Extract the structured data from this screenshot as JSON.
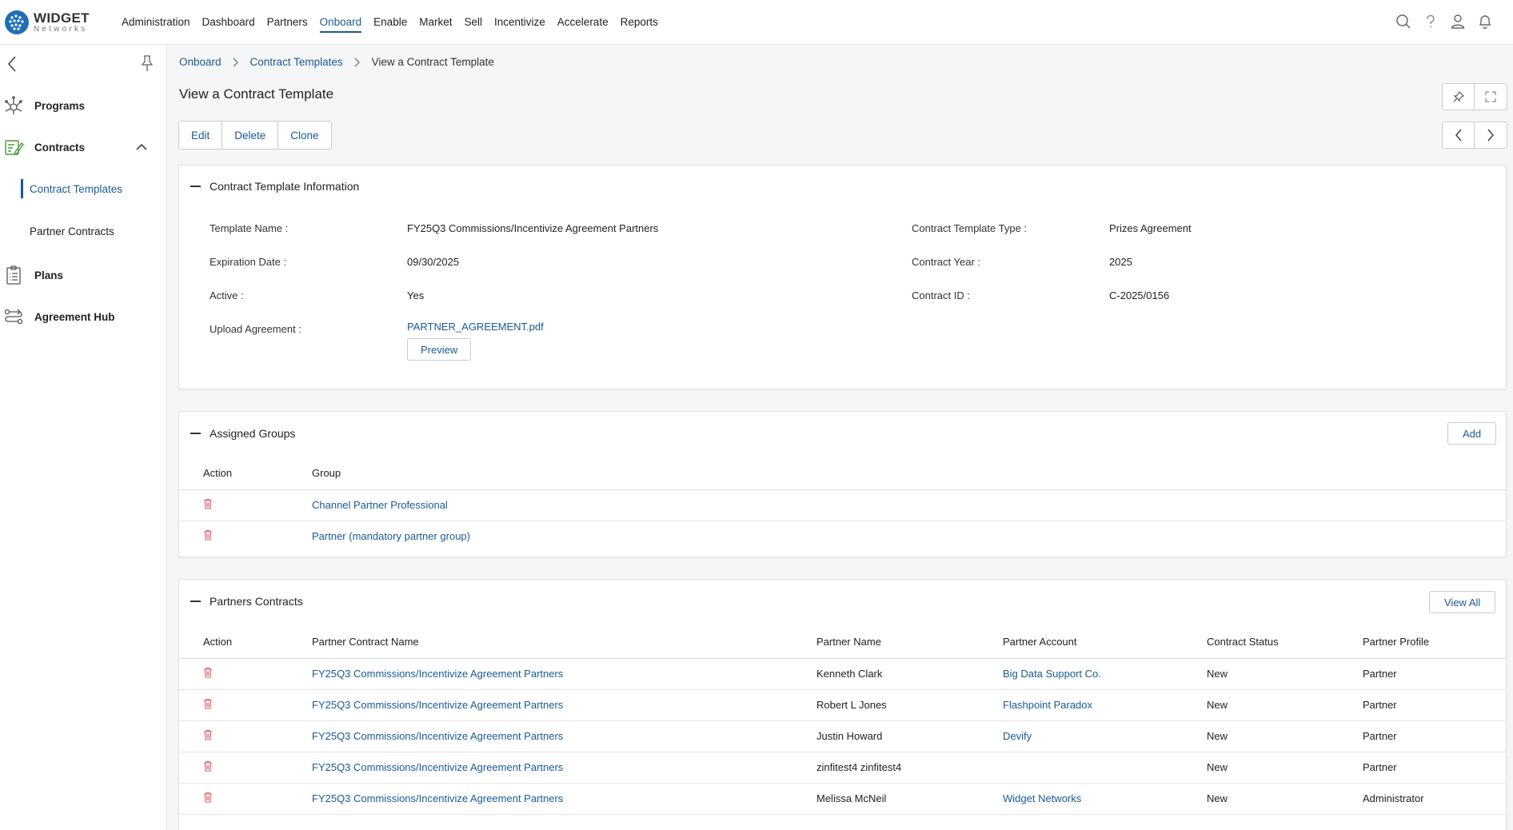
{
  "brand": {
    "name": "WIDGET",
    "sub": "Networks"
  },
  "topnav": {
    "items": [
      {
        "label": "Administration",
        "active": false
      },
      {
        "label": "Dashboard",
        "active": false
      },
      {
        "label": "Partners",
        "active": false
      },
      {
        "label": "Onboard",
        "active": true
      },
      {
        "label": "Enable",
        "active": false
      },
      {
        "label": "Market",
        "active": false
      },
      {
        "label": "Sell",
        "active": false
      },
      {
        "label": "Incentivize",
        "active": false
      },
      {
        "label": "Accelerate",
        "active": false
      },
      {
        "label": "Reports",
        "active": false
      }
    ],
    "icons": [
      "search-icon",
      "help-icon",
      "user-icon",
      "bell-icon"
    ]
  },
  "sidebar": {
    "items": [
      {
        "label": "Programs",
        "icon": "programs-icon"
      },
      {
        "label": "Contracts",
        "icon": "contracts-icon",
        "expanded": true
      },
      {
        "label": "Plans",
        "icon": "plans-icon"
      },
      {
        "label": "Agreement Hub",
        "icon": "agreement-hub-icon"
      }
    ],
    "subitems": [
      {
        "label": "Contract Templates",
        "active": true
      },
      {
        "label": "Partner Contracts",
        "active": false
      }
    ]
  },
  "breadcrumb": [
    "Onboard",
    "Contract Templates",
    "View a Contract Template"
  ],
  "page": {
    "title": "View a Contract Template"
  },
  "actions": {
    "edit": "Edit",
    "delete": "Delete",
    "clone": "Clone"
  },
  "info": {
    "title": "Contract Template Information",
    "template_name_label": "Template Name :",
    "template_name": "FY25Q3 Commissions/Incentivize Agreement Partners",
    "expiration_label": "Expiration Date :",
    "expiration": "09/30/2025",
    "active_label": "Active :",
    "active": "Yes",
    "upload_label": "Upload Agreement :",
    "upload_file": "PARTNER_AGREEMENT.pdf",
    "preview": "Preview",
    "type_label": "Contract Template Type :",
    "type": "Prizes Agreement",
    "year_label": "Contract Year :",
    "year": "2025",
    "id_label": "Contract ID :",
    "id": "C-2025/0156"
  },
  "groups": {
    "title": "Assigned Groups",
    "add": "Add",
    "col_action": "Action",
    "col_group": "Group",
    "rows": [
      {
        "group": "Channel Partner Professional"
      },
      {
        "group": "Partner (mandatory partner group)"
      }
    ]
  },
  "contracts": {
    "title": "Partners Contracts",
    "view_all": "View All",
    "columns": [
      "Action",
      "Partner Contract Name",
      "Partner Name",
      "Partner Account",
      "Contract Status",
      "Partner Profile"
    ],
    "rows": [
      {
        "name": "FY25Q3 Commissions/Incentivize Agreement Partners",
        "partner": "Kenneth Clark",
        "account": "Big Data Support Co.",
        "status": "New",
        "profile": "Partner"
      },
      {
        "name": "FY25Q3 Commissions/Incentivize Agreement Partners",
        "partner": "Robert L Jones",
        "account": "Flashpoint Paradox",
        "status": "New",
        "profile": "Partner"
      },
      {
        "name": "FY25Q3 Commissions/Incentivize Agreement Partners",
        "partner": "Justin Howard",
        "account": "Devify",
        "status": "New",
        "profile": "Partner"
      },
      {
        "name": "FY25Q3 Commissions/Incentivize Agreement Partners",
        "partner": "zinfitest4 zinfitest4",
        "account": "",
        "status": "New",
        "profile": "Partner"
      },
      {
        "name": "FY25Q3 Commissions/Incentivize Agreement Partners",
        "partner": "Melissa McNeil",
        "account": "Widget Networks",
        "status": "New",
        "profile": "Administrator"
      }
    ]
  },
  "colors": {
    "accent": "#1a5a96",
    "delete": "#e05a5a",
    "brand": "#1e6fb8"
  }
}
